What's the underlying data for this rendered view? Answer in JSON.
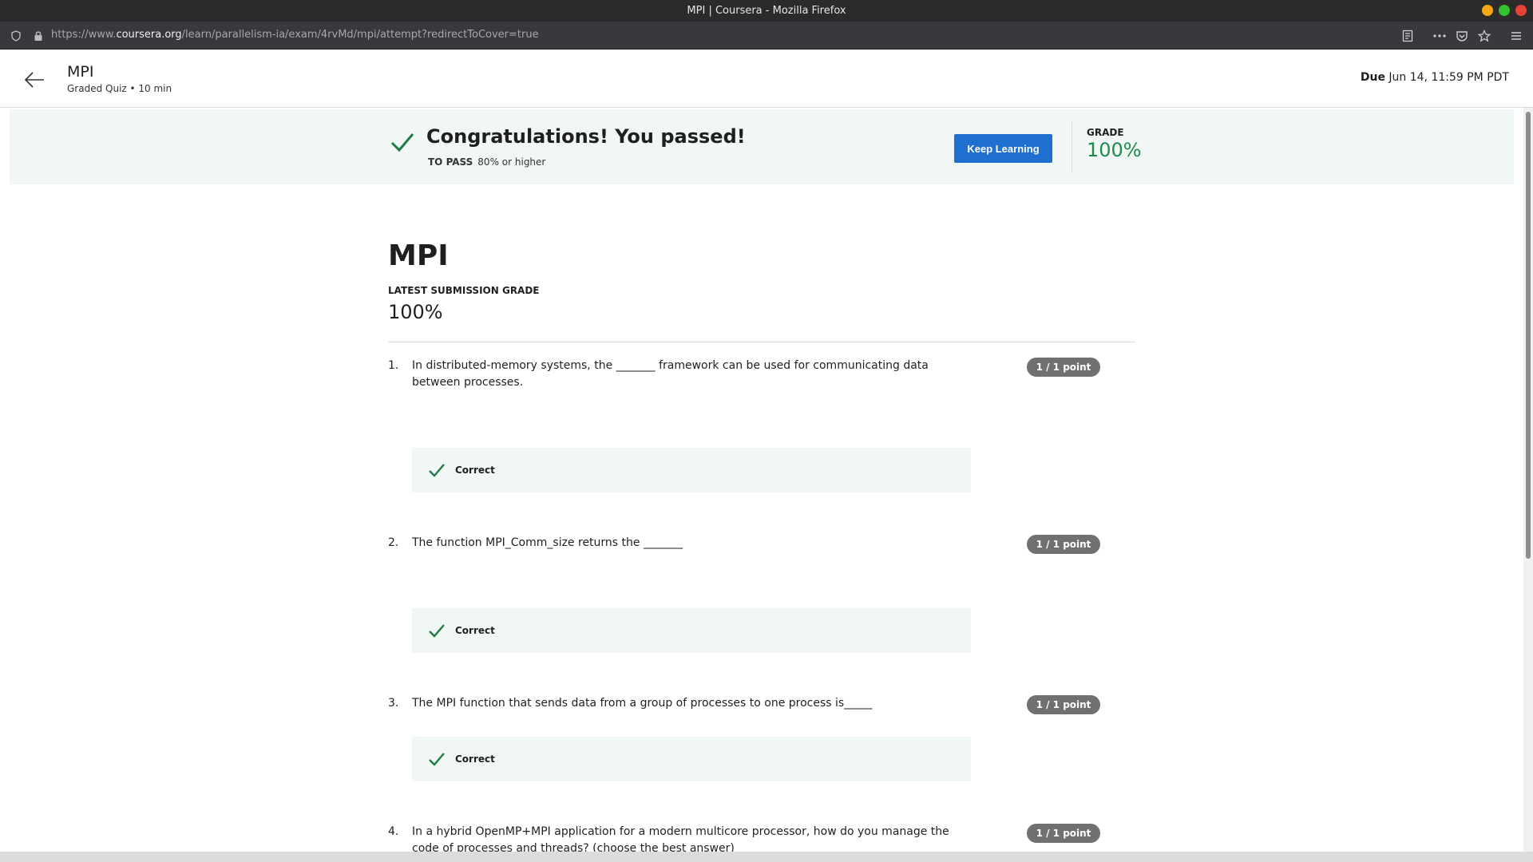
{
  "window": {
    "title": "MPI | Coursera - Mozilla Firefox",
    "controls": [
      "minimize",
      "maximize",
      "close"
    ],
    "colors": {
      "minimize": "#f6a913",
      "maximize": "#36c12f",
      "close": "#e8413a"
    }
  },
  "browser": {
    "url_prefix": "https://www.",
    "url_domain": "coursera.org",
    "url_path": "/learn/parallelism-ia/exam/4rvMd/mpi/attempt?redirectToCover=true",
    "icons": [
      "shield-icon",
      "lock-icon",
      "reader-view-icon",
      "more-icon",
      "pocket-icon",
      "bookmark-star-icon",
      "menu-icon"
    ]
  },
  "header": {
    "title": "MPI",
    "subtitle": "Graded Quiz • 10 min",
    "due_label": "Due",
    "due_value": "Jun 14, 11:59 PM PDT"
  },
  "banner": {
    "title": "Congratulations! You passed!",
    "pass_label": "TO PASS",
    "pass_value": "80% or higher",
    "button_label": "Keep Learning",
    "grade_label": "GRADE",
    "grade_value": "100%",
    "accent_color": "#1e8a4c",
    "button_color": "#1f6fd1"
  },
  "main": {
    "title": "MPI",
    "latest_label": "LATEST SUBMISSION GRADE",
    "latest_value": "100%"
  },
  "questions": [
    {
      "num": "1.",
      "text": "In distributed-memory systems, the _______ framework can be used for communicating data between processes.",
      "points": "1 / 1 point",
      "feedback": "Correct"
    },
    {
      "num": "2.",
      "text": "The function MPI_Comm_size returns the _______",
      "points": "1 / 1 point",
      "feedback": "Correct"
    },
    {
      "num": "3.",
      "text": "The MPI function that sends data from a group of processes to one process is_____",
      "points": "1 / 1 point",
      "feedback": "Correct"
    },
    {
      "num": "4.",
      "text": "In a hybrid OpenMP+MPI application for a modern multicore processor, how do you manage the code of processes and threads? (choose the best answer)",
      "points": "1 / 1 point"
    }
  ]
}
